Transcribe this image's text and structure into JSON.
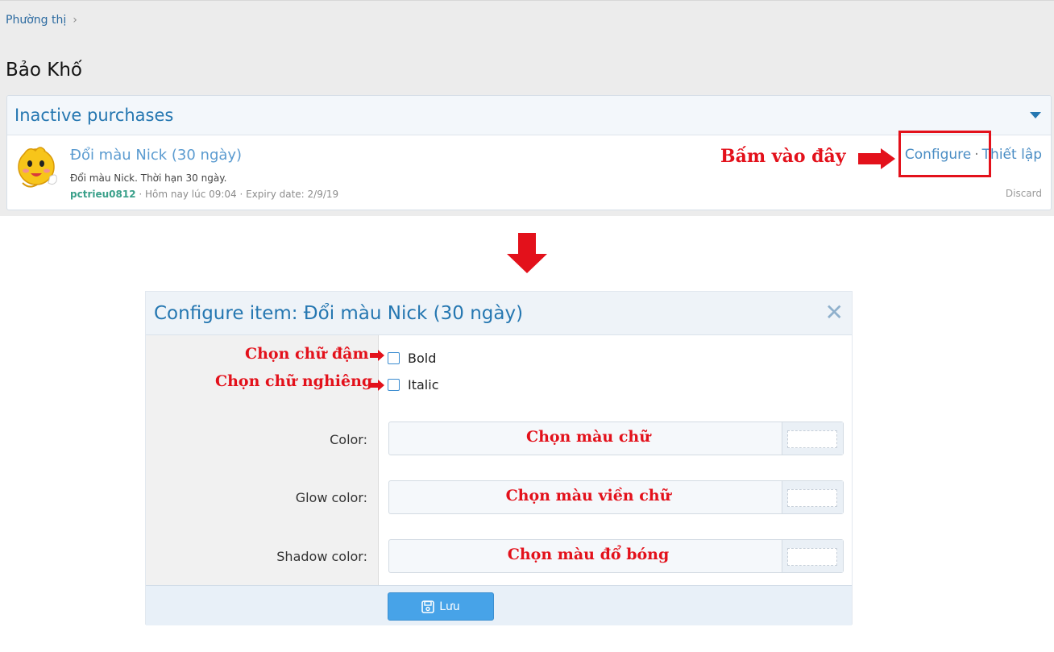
{
  "breadcrumb": {
    "item": "Phường thị",
    "chevron": "›"
  },
  "page": {
    "title": "Bảo Khố"
  },
  "block": {
    "header_title": "Inactive purchases",
    "purchase": {
      "title": "Đổi màu Nick (30 ngày)",
      "description": "Đổi màu Nick. Thời hạn 30 ngày.",
      "user": "pctrieu0812",
      "meta_rest": " · Hôm nay lúc 09:04 · Expiry date: 2/9/19",
      "configure_label": "Configure",
      "separator": "·",
      "setup_label": "Thiết lập",
      "discard_label": "Discard"
    }
  },
  "annotations": {
    "click_here": "Bấm vào đây",
    "bold_note": "Chọn chữ đậm",
    "italic_note": "Chọn chữ nghiêng",
    "color_note": "Chọn màu chữ",
    "glow_note": "Chọn màu viền chữ",
    "shadow_note": "Chọn màu đổ bóng",
    "accent_color": "#e3111b"
  },
  "dialog": {
    "title": "Configure item: Đổi màu Nick (30 ngày)",
    "close_symbol": "✕",
    "bold_label": "Bold",
    "italic_label": "Italic",
    "color_label": "Color:",
    "glow_label": "Glow color:",
    "shadow_label": "Shadow color:",
    "save_label": "Lưu"
  }
}
